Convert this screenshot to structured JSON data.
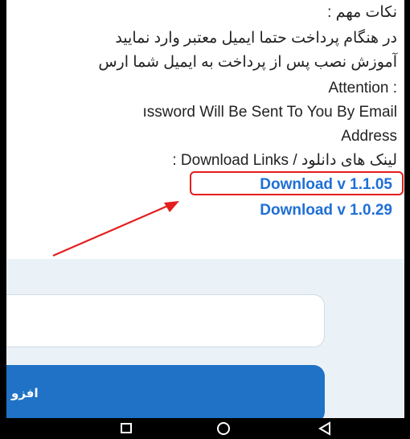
{
  "content": {
    "important_notes": "نکات مهم :",
    "payment_note": "در هنگام پرداخت حتما ایمیل معتبر وارد نمایید",
    "install_note": "آموزش نصب پس از پرداخت به ایمیل شما ارس",
    "attention_label": ": Attention",
    "password_note": "ıssword Will Be Sent To You By Email",
    "address_word": "Address",
    "download_links_label": "لینک های دانلود / Download Links :",
    "download_links": [
      {
        "label": "Download v 1.1.05",
        "highlighted": true
      },
      {
        "label": "Download v 1.0.29",
        "highlighted": false
      }
    ]
  },
  "form": {
    "input_value": "",
    "add_button_label": "افزو"
  },
  "navbar": {
    "icons": [
      "recent-apps-icon",
      "home-icon",
      "back-icon"
    ]
  },
  "colors": {
    "link": "#1f6fd6",
    "highlight_box": "#e41e1e",
    "arrow": "#e41e1e",
    "button": "#1f72c6",
    "form_bg": "#eaf2f8"
  }
}
